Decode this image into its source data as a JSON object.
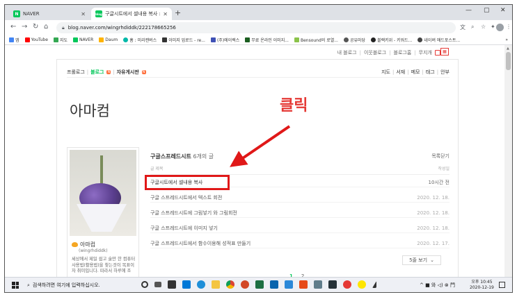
{
  "browser": {
    "tabs": [
      {
        "label": "NAVER",
        "favicon": "N"
      },
      {
        "label": "구글시트에서 셀내용 복사 : 네이",
        "favicon": "blog"
      }
    ],
    "new_tab": "+",
    "address": "blog.naver.com/wingrhdiddk/222178665256",
    "window_controls": {
      "minimize": "—",
      "maximize": "▢",
      "close": "✕"
    },
    "bookmarks": [
      {
        "label": "앱",
        "color": "#4285f4"
      },
      {
        "label": "YouTube",
        "color": "#ff0000"
      },
      {
        "label": "지도",
        "color": "#34a853"
      },
      {
        "label": "NAVER",
        "color": "#03c75a"
      },
      {
        "label": "Daum",
        "color": "#ffb300"
      },
      {
        "label": "홈 : 미리캔버스",
        "color": "#00b8a9"
      },
      {
        "label": "이미지 업로드 - re...",
        "color": "#333333"
      },
      {
        "label": "(주)에이렉스",
        "color": "#3f51b5"
      },
      {
        "label": "무료 온라인 이미지...",
        "color": "#1b5e20"
      },
      {
        "label": "Bensound의 로열...",
        "color": "#8bc34a"
      },
      {
        "label": "공유마당",
        "color": "#555555"
      },
      {
        "label": "블랙키위 - 키워드...",
        "color": "#222222"
      },
      {
        "label": "네이버 애드포스트...",
        "color": "#444444"
      }
    ],
    "bookmarks_more": "»"
  },
  "blog": {
    "top_nav": [
      "내 블로그",
      "이웃블로그",
      "블로그홈",
      "무지개"
    ],
    "menu_left": [
      {
        "label": "프롤로그",
        "active": false,
        "new": false
      },
      {
        "label": "블로그",
        "active": true,
        "new": true
      },
      {
        "label": "자유게시판",
        "active": false,
        "new": true
      }
    ],
    "new_badge": "N",
    "menu_right": [
      "지도",
      "서재",
      "메모",
      "태그",
      "안부"
    ],
    "title": "아마컴",
    "annotation": "클릭",
    "profile": {
      "name": "아마컴",
      "id": "(wingrhdiddk)",
      "description": "세상에서 제일 쉽고 술만 한 컴퓨터 사용법(활용법)을 찾는것이 목표이자 취미입니다. 따라서 하루에 조"
    },
    "post_list": {
      "category": "구글스프레드시트",
      "count_text": "6개의 글",
      "close_label": "목록닫기",
      "col_title": "글 제목",
      "col_date": "작성일",
      "rows": [
        {
          "title": "구글시트에서 셀내용 복사",
          "date": "10시간 전"
        },
        {
          "title": "구글 스프레드시트에서 텍스트 회전",
          "date": "2020. 12. 18."
        },
        {
          "title": "구글 스프레드시트에 그림넣기 와 그림회전",
          "date": "2020. 12. 18."
        },
        {
          "title": "구글 스프레드시트에 이미지 넣기",
          "date": "2020. 12. 18."
        },
        {
          "title": "구글 스프레드시트에서 함수이용해 성적표 만들기",
          "date": "2020. 12. 17."
        }
      ],
      "view_more": "5줄 보기",
      "pages": [
        "1",
        "2"
      ]
    }
  },
  "taskbar": {
    "search_placeholder": "검색하려면 여기에 입력하십시오.",
    "tray": "^ ■ 와 ◁) ⊗ 門",
    "time": "오후 10:45",
    "date": "2020-12-19"
  },
  "colors": {
    "accent_green": "#03c75a",
    "annotation_red": "#e01818"
  }
}
